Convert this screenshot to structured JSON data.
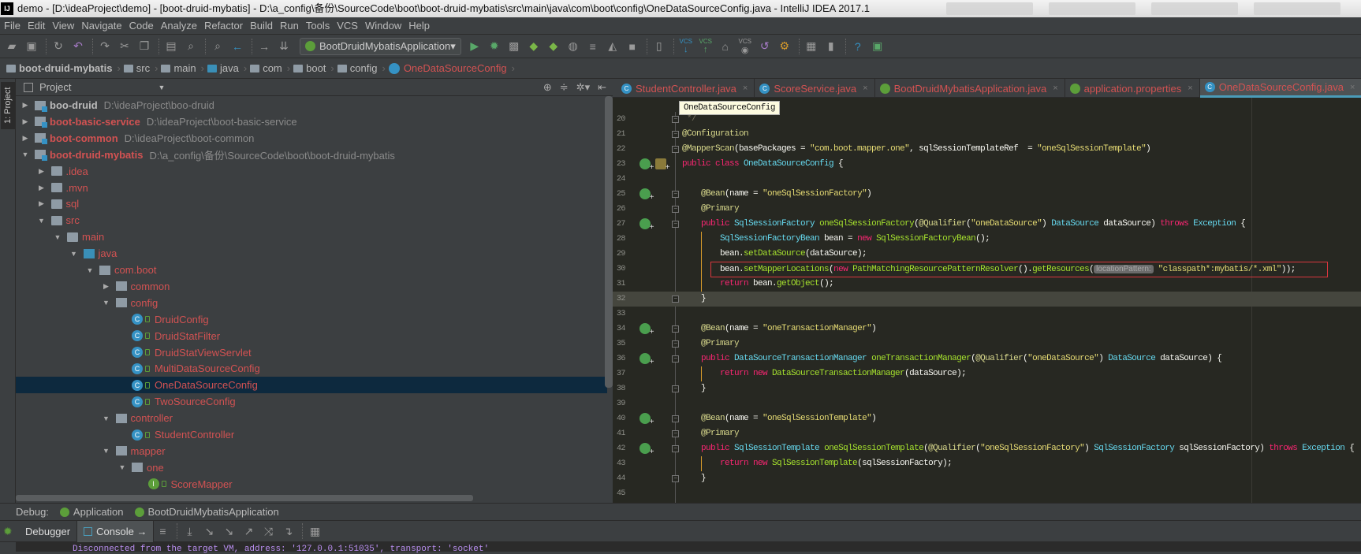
{
  "window": {
    "title": "demo - [D:\\ideaProject\\demo] - [boot-druid-mybatis] - D:\\a_config\\备份\\SourceCode\\boot\\boot-druid-mybatis\\src\\main\\java\\com\\boot\\config\\OneDataSourceConfig.java - IntelliJ IDEA 2017.1",
    "logo": "IJ"
  },
  "menu": [
    "File",
    "Edit",
    "View",
    "Navigate",
    "Code",
    "Analyze",
    "Refactor",
    "Build",
    "Run",
    "Tools",
    "VCS",
    "Window",
    "Help"
  ],
  "toolbar": {
    "run_config": "BootDruidMybatisApplication",
    "icons_left": [
      "open-icon",
      "save-icon",
      "sync-icon",
      "undo-icon",
      "redo-icon",
      "cut-icon",
      "copy-icon",
      "paste-icon",
      "find-icon",
      "replace-icon",
      "back-icon",
      "forward-icon",
      "build-icon"
    ],
    "icons_right": [
      "run-icon",
      "debug-icon",
      "coverage-icon",
      "jrebel-run-icon",
      "jrebel-debug-icon",
      "profile-icon",
      "threads-icon",
      "build-artifacts-icon",
      "stop-icon",
      "device-icon",
      "vcs-update-icon",
      "vcs-commit-icon",
      "vcs-history-icon",
      "vcs-compare-icon",
      "revert-icon",
      "settings-icon",
      "project-structure-icon",
      "sdk-icon",
      "help-icon",
      "plugin-icon"
    ],
    "vcs_label": "VCS"
  },
  "breadcrumb": [
    "boot-druid-mybatis",
    "src",
    "main",
    "java",
    "com",
    "boot",
    "config",
    "OneDataSourceConfig"
  ],
  "project_panel": {
    "title": "Project",
    "strip_label": "1: Project"
  },
  "tree": [
    {
      "level": 0,
      "label": "boo-druid",
      "path": "D:\\ideaProject\\boo-druid",
      "icon": "mod",
      "arrow": "right",
      "bold": true,
      "white": true
    },
    {
      "level": 0,
      "label": "boot-basic-service",
      "path": "D:\\ideaProject\\boot-basic-service",
      "icon": "mod",
      "arrow": "right",
      "bold": true
    },
    {
      "level": 0,
      "label": "boot-common",
      "path": "D:\\ideaProject\\boot-common",
      "icon": "mod",
      "arrow": "right",
      "bold": true
    },
    {
      "level": 0,
      "label": "boot-druid-mybatis",
      "path": "D:\\a_config\\备份\\SourceCode\\boot\\boot-druid-mybatis",
      "icon": "mod",
      "arrow": "down",
      "bold": true
    },
    {
      "level": 1,
      "label": ".idea",
      "icon": "folder",
      "arrow": "right"
    },
    {
      "level": 1,
      "label": ".mvn",
      "icon": "folder",
      "arrow": "right"
    },
    {
      "level": 1,
      "label": "sql",
      "icon": "folder",
      "arrow": "right"
    },
    {
      "level": 1,
      "label": "src",
      "icon": "folder",
      "arrow": "down"
    },
    {
      "level": 2,
      "label": "main",
      "icon": "folder",
      "arrow": "down"
    },
    {
      "level": 3,
      "label": "java",
      "icon": "src",
      "arrow": "down"
    },
    {
      "level": 4,
      "label": "com.boot",
      "icon": "pkg",
      "arrow": "down"
    },
    {
      "level": 5,
      "label": "common",
      "icon": "pkg",
      "arrow": "right"
    },
    {
      "level": 5,
      "label": "config",
      "icon": "pkg",
      "arrow": "down"
    },
    {
      "level": 6,
      "label": "DruidConfig",
      "icon": "cls"
    },
    {
      "level": 6,
      "label": "DruidStatFilter",
      "icon": "cls"
    },
    {
      "level": 6,
      "label": "DruidStatViewServlet",
      "icon": "cls"
    },
    {
      "level": 6,
      "label": "MultiDataSourceConfig",
      "icon": "cls"
    },
    {
      "level": 6,
      "label": "OneDataSourceConfig",
      "icon": "cls",
      "selected": true
    },
    {
      "level": 6,
      "label": "TwoSourceConfig",
      "icon": "cls"
    },
    {
      "level": 5,
      "label": "controller",
      "icon": "pkg",
      "arrow": "down"
    },
    {
      "level": 6,
      "label": "StudentController",
      "icon": "cls"
    },
    {
      "level": 5,
      "label": "mapper",
      "icon": "pkg",
      "arrow": "down"
    },
    {
      "level": 6,
      "label": "one",
      "icon": "pkg",
      "arrow": "down"
    },
    {
      "level": 7,
      "label": "ScoreMapper",
      "icon": "ifc"
    }
  ],
  "tabs": [
    {
      "label": "StudentController.java",
      "icon": "C"
    },
    {
      "label": "ScoreService.java",
      "icon": "C"
    },
    {
      "label": "BootDruidMybatisApplication.java",
      "icon": "S"
    },
    {
      "label": "application.properties",
      "icon": "S"
    },
    {
      "label": "OneDataSourceConfig.java",
      "icon": "C",
      "active": true
    }
  ],
  "tab_close": "×",
  "tooltip": "OneDataSourceConfig",
  "code": {
    "first_line": 20,
    "current_line": 32,
    "highlighted_line": 30,
    "bean_lines": [
      23,
      25,
      27,
      34,
      36,
      40,
      42
    ],
    "fold_lines": [
      20,
      21,
      22,
      25,
      26,
      27,
      32,
      34,
      35,
      36,
      38,
      40,
      41,
      42,
      44
    ],
    "lines": [
      [
        [
          "c",
          " */"
        ]
      ],
      [
        [
          "a",
          "@Configuration"
        ]
      ],
      [
        [
          "a",
          "@MapperScan"
        ],
        [
          "p",
          "(basePackages = "
        ],
        [
          "s",
          "\"com.boot.mapper.one\""
        ],
        [
          "p",
          ", sqlSessionTemplateRef  = "
        ],
        [
          "s",
          "\"oneSqlSessionTemplate\""
        ],
        [
          "p",
          ")"
        ]
      ],
      [
        [
          "k",
          "public class "
        ],
        [
          "t",
          "OneDataSourceConfig"
        ],
        [
          "p",
          " {"
        ]
      ],
      [],
      [
        [
          "p",
          "    "
        ],
        [
          "a",
          "@Bean"
        ],
        [
          "p",
          "(name = "
        ],
        [
          "s",
          "\"oneSqlSessionFactory\""
        ],
        [
          "p",
          ")"
        ]
      ],
      [
        [
          "p",
          "    "
        ],
        [
          "a",
          "@Primary"
        ]
      ],
      [
        [
          "p",
          "    "
        ],
        [
          "k",
          "public "
        ],
        [
          "t",
          "SqlSessionFactory "
        ],
        [
          "m",
          "oneSqlSessionFactory"
        ],
        [
          "p",
          "("
        ],
        [
          "a",
          "@Qualifier"
        ],
        [
          "p",
          "("
        ],
        [
          "s",
          "\"oneDataSource\""
        ],
        [
          "p",
          ") "
        ],
        [
          "t",
          "DataSource "
        ],
        [
          "p",
          "dataSource) "
        ],
        [
          "k",
          "throws "
        ],
        [
          "t",
          "Exception "
        ],
        [
          "p",
          "{"
        ]
      ],
      [
        [
          "p",
          "        "
        ],
        [
          "t",
          "SqlSessionFactoryBean "
        ],
        [
          "p",
          "bean = "
        ],
        [
          "k",
          "new "
        ],
        [
          "m",
          "SqlSessionFactoryBean"
        ],
        [
          "p",
          "();"
        ]
      ],
      [
        [
          "p",
          "        bean."
        ],
        [
          "m",
          "setDataSource"
        ],
        [
          "p",
          "(dataSource);"
        ]
      ],
      [
        [
          "p",
          "        bean."
        ],
        [
          "m",
          "setMapperLocations"
        ],
        [
          "p",
          "("
        ],
        [
          "k",
          "new "
        ],
        [
          "m",
          "PathMatchingResourcePatternResolver"
        ],
        [
          "p",
          "()."
        ],
        [
          "m",
          "getResources"
        ],
        [
          "p",
          "("
        ],
        [
          "h",
          "locationPattern:"
        ],
        [
          "s",
          " \"classpath*:mybatis/*.xml\""
        ],
        [
          "p",
          "));"
        ]
      ],
      [
        [
          "p",
          "        "
        ],
        [
          "k",
          "return "
        ],
        [
          "p",
          "bean."
        ],
        [
          "m",
          "getObject"
        ],
        [
          "p",
          "();"
        ]
      ],
      [
        [
          "p",
          "    }"
        ]
      ],
      [],
      [
        [
          "p",
          "    "
        ],
        [
          "a",
          "@Bean"
        ],
        [
          "p",
          "(name = "
        ],
        [
          "s",
          "\"oneTransactionManager\""
        ],
        [
          "p",
          ")"
        ]
      ],
      [
        [
          "p",
          "    "
        ],
        [
          "a",
          "@Primary"
        ]
      ],
      [
        [
          "p",
          "    "
        ],
        [
          "k",
          "public "
        ],
        [
          "t",
          "DataSourceTransactionManager "
        ],
        [
          "m",
          "oneTransactionManager"
        ],
        [
          "p",
          "("
        ],
        [
          "a",
          "@Qualifier"
        ],
        [
          "p",
          "("
        ],
        [
          "s",
          "\"oneDataSource\""
        ],
        [
          "p",
          ") "
        ],
        [
          "t",
          "DataSource "
        ],
        [
          "p",
          "dataSource) {"
        ]
      ],
      [
        [
          "p",
          "        "
        ],
        [
          "k",
          "return new "
        ],
        [
          "m",
          "DataSourceTransactionManager"
        ],
        [
          "p",
          "(dataSource);"
        ]
      ],
      [
        [
          "p",
          "    }"
        ]
      ],
      [],
      [
        [
          "p",
          "    "
        ],
        [
          "a",
          "@Bean"
        ],
        [
          "p",
          "(name = "
        ],
        [
          "s",
          "\"oneSqlSessionTemplate\""
        ],
        [
          "p",
          ")"
        ]
      ],
      [
        [
          "p",
          "    "
        ],
        [
          "a",
          "@Primary"
        ]
      ],
      [
        [
          "p",
          "    "
        ],
        [
          "k",
          "public "
        ],
        [
          "t",
          "SqlSessionTemplate "
        ],
        [
          "m",
          "oneSqlSessionTemplate"
        ],
        [
          "p",
          "("
        ],
        [
          "a",
          "@Qualifier"
        ],
        [
          "p",
          "("
        ],
        [
          "s",
          "\"oneSqlSessionFactory\""
        ],
        [
          "p",
          ") "
        ],
        [
          "t",
          "SqlSessionFactory "
        ],
        [
          "p",
          "sqlSessionFactory) "
        ],
        [
          "k",
          "throws "
        ],
        [
          "t",
          "Exception "
        ],
        [
          "p",
          "{"
        ]
      ],
      [
        [
          "p",
          "        "
        ],
        [
          "k",
          "return new "
        ],
        [
          "m",
          "SqlSessionTemplate"
        ],
        [
          "p",
          "(sqlSessionFactory);"
        ]
      ],
      [
        [
          "p",
          "    }"
        ]
      ],
      []
    ]
  },
  "debug": {
    "label": "Debug:",
    "sessions": [
      "Application",
      "BootDruidMybatisApplication"
    ],
    "tabs": [
      "Debugger",
      "Console"
    ],
    "console_text": "Disconnected from the target VM, address: '127.0.0.1:51035', transport: 'socket'"
  },
  "colors": {
    "accent": "#4a9bb8",
    "selection": "#0d293e",
    "unversioned": "#d25252",
    "editor_bg": "#272822"
  }
}
